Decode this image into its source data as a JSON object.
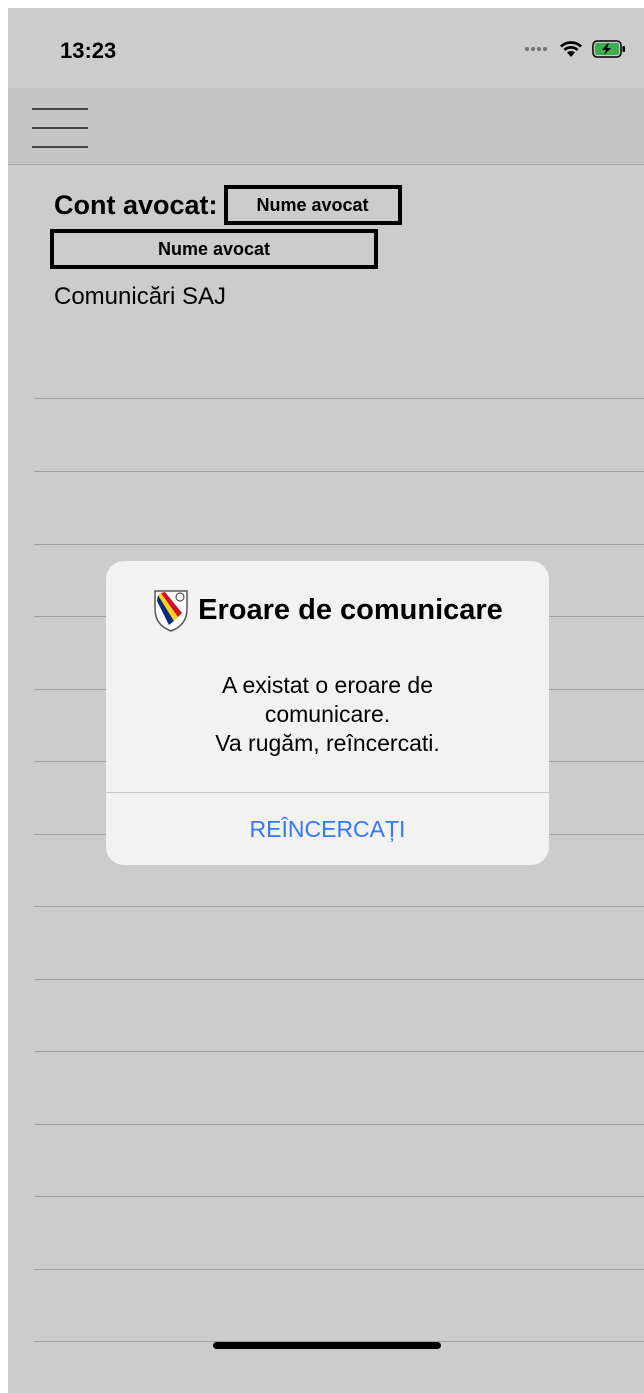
{
  "status_bar": {
    "time": "13:23",
    "signal_icon": "signal-dots-icon",
    "wifi_icon": "wifi-icon",
    "battery_icon": "battery-charging-icon",
    "battery_color": "#4cd964"
  },
  "nav": {
    "menu_icon": "hamburger-menu-icon"
  },
  "account": {
    "label": "Cont avocat:",
    "name_primary": "Nume avocat",
    "name_secondary": "Nume avocat"
  },
  "section": {
    "title": "Comunicări SAJ"
  },
  "alert": {
    "icon": "coat-of-arms-icon",
    "title": "Eroare de comunicare",
    "message_lines": [
      "A existat o eroare de",
      "comunicare.",
      "Va rugăm, reîncercati."
    ],
    "button_label": "REÎNCERCAȚI",
    "button_color": "#3478f6"
  }
}
